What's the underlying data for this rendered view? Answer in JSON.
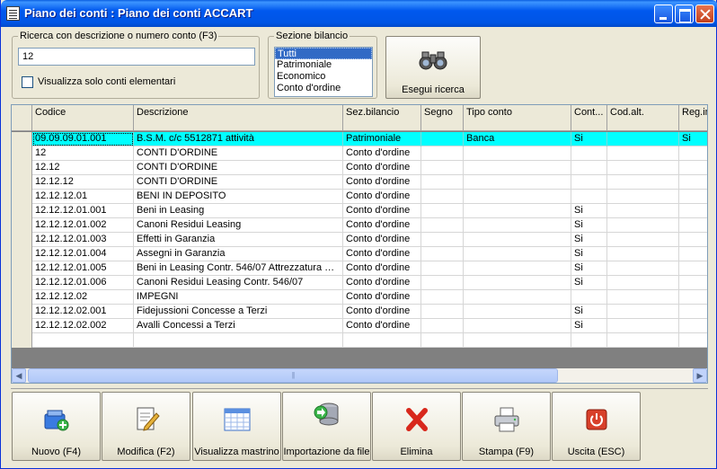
{
  "window": {
    "title": "Piano dei conti : Piano dei conti ACCART"
  },
  "search": {
    "legend": "Ricerca con descrizione o numero conto (F3)",
    "value": "12",
    "checkbox_label": "Visualizza solo conti elementari"
  },
  "sezione": {
    "legend": "Sezione bilancio",
    "options": [
      "Tutti",
      "Patrimoniale",
      "Economico",
      "Conto d'ordine"
    ],
    "selected": "Tutti"
  },
  "search_button": {
    "label": "Esegui ricerca",
    "icon": "binoculars-icon"
  },
  "grid": {
    "columns": [
      "Codice",
      "Descrizione",
      "Sez.bilancio",
      "Segno",
      "Tipo conto",
      "Cont...",
      "Cod.alt.",
      "Reg.in"
    ],
    "rows": [
      [
        "09.09.09.01.001",
        "B.S.M. c/c 5512871 attività",
        "Patrimoniale",
        "",
        "Banca",
        "Si",
        "",
        "Si"
      ],
      [
        "12",
        "CONTI D'ORDINE",
        "Conto d'ordine",
        "",
        "",
        "",
        "",
        ""
      ],
      [
        "12.12",
        "CONTI D'ORDINE",
        "Conto d'ordine",
        "",
        "",
        "",
        "",
        ""
      ],
      [
        "12.12.12",
        "CONTI D'ORDINE",
        "Conto d'ordine",
        "",
        "",
        "",
        "",
        ""
      ],
      [
        "12.12.12.01",
        "BENI IN DEPOSITO",
        "Conto d'ordine",
        "",
        "",
        "",
        "",
        ""
      ],
      [
        "12.12.12.01.001",
        "Beni in Leasing",
        "Conto d'ordine",
        "",
        "",
        "Si",
        "",
        ""
      ],
      [
        "12.12.12.01.002",
        "Canoni Residui Leasing",
        "Conto d'ordine",
        "",
        "",
        "Si",
        "",
        ""
      ],
      [
        "12.12.12.01.003",
        "Effetti in Garanzia",
        "Conto d'ordine",
        "",
        "",
        "Si",
        "",
        ""
      ],
      [
        "12.12.12.01.004",
        "Assegni in Garanzia",
        "Conto d'ordine",
        "",
        "",
        "Si",
        "",
        ""
      ],
      [
        "12.12.12.01.005",
        "Beni in Leasing Contr. 546/07 Attrezzatura per...",
        "Conto d'ordine",
        "",
        "",
        "Si",
        "",
        ""
      ],
      [
        "12.12.12.01.006",
        "Canoni Residui Leasing Contr. 546/07",
        "Conto d'ordine",
        "",
        "",
        "Si",
        "",
        ""
      ],
      [
        "12.12.12.02",
        "IMPEGNI",
        "Conto d'ordine",
        "",
        "",
        "",
        "",
        ""
      ],
      [
        "12.12.12.02.001",
        "Fidejussioni Concesse a Terzi",
        "Conto d'ordine",
        "",
        "",
        "Si",
        "",
        ""
      ],
      [
        "12.12.12.02.002",
        "Avalli Concessi a Terzi",
        "Conto d'ordine",
        "",
        "",
        "Si",
        "",
        ""
      ]
    ],
    "highlight_color": "#00ffff"
  },
  "toolbar": [
    {
      "label": "Nuovo (F4)",
      "icon": "new-account-icon"
    },
    {
      "label": "Modifica (F2)",
      "icon": "edit-document-icon"
    },
    {
      "label": "Visualizza mastrino",
      "icon": "calendar-grid-icon"
    },
    {
      "label": "Importazione da file",
      "icon": "database-import-icon"
    },
    {
      "label": "Elimina",
      "icon": "delete-x-icon"
    },
    {
      "label": "Stampa (F9)",
      "icon": "printer-icon"
    },
    {
      "label": "Uscita (ESC)",
      "icon": "power-exit-icon"
    }
  ]
}
